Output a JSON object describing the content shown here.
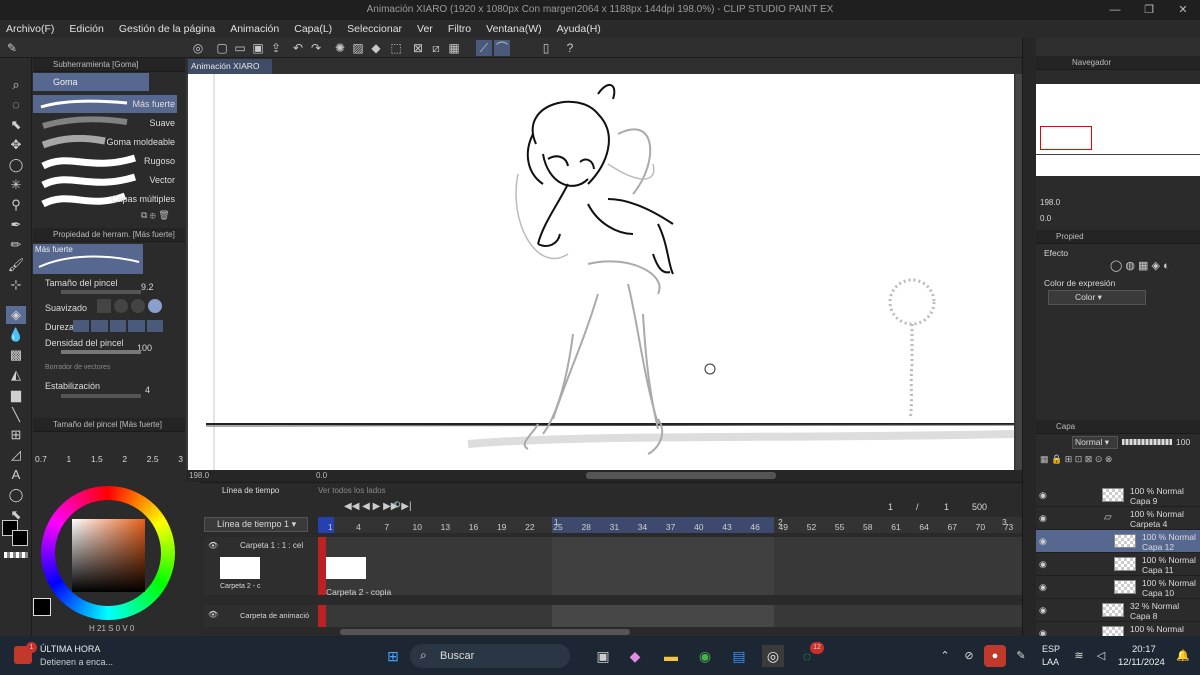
{
  "window": {
    "title": "Animación XIARO (1920 x 1080px Con margen2064 x 1188px 144dpi 198.0%)  - CLIP STUDIO PAINT EX",
    "minimize": "—",
    "restore": "❐",
    "close": "✕"
  },
  "menu": [
    "Archivo(F)",
    "Edición",
    "Gestión de la página",
    "Animación",
    "Capa(L)",
    "Seleccionar",
    "Ver",
    "Filtro",
    "Ventana(W)",
    "Ayuda(H)"
  ],
  "subtool": {
    "header": "Subherramienta [Goma]",
    "group": "Goma",
    "items": [
      "Más fuerte",
      "Suave",
      "Goma moldeable",
      "Rugoso",
      "Vector",
      "Capas múltiples"
    ]
  },
  "toolprop": {
    "header": "Propiedad de herram. [Más fuerte]",
    "preview_label": "Más fuerte",
    "brush_size_label": "Tamaño del pincel",
    "brush_size_value": "9.2",
    "smoothing_label": "Suavizado",
    "hardness_label": "Dureza",
    "density_label": "Densidad del pincel",
    "density_value": "100",
    "vector_erase_label": "Borrador de vectores",
    "stabilization_label": "Estabilización",
    "stabilization_value": "4"
  },
  "brushsize": {
    "header": "Tamaño del pincel [Más fuerte]",
    "sizes": [
      "0.7",
      "1",
      "1.5",
      "2",
      "2.5",
      "3"
    ]
  },
  "colorpanel": {
    "footer": "H 21  S 0  V 0"
  },
  "document": {
    "tab": "Animación XIARO",
    "tab_close": "✕",
    "zoom": "198.0",
    "angle": "0.0"
  },
  "timeline": {
    "tab": "Línea de tiempo",
    "tab2": "Ver todos los lados",
    "select": "Línea de tiempo 1",
    "frame_current": "1",
    "frame_sep": "/",
    "frame_start": "1",
    "frame_total": "500",
    "tracks": [
      {
        "name": "Carpeta 1 : 1 : cel",
        "cel1": "Carpeta 2 - c",
        "cel2": "Carpeta 2 - copia"
      },
      {
        "name": "Carpeta de animació"
      }
    ],
    "ticks": [
      "1",
      "4",
      "7",
      "10",
      "13",
      "16",
      "19",
      "22",
      "25",
      "28",
      "31",
      "34",
      "37",
      "40",
      "43",
      "46",
      "49",
      "52",
      "55",
      "58",
      "61",
      "64",
      "67",
      "70",
      "73"
    ],
    "section_labels": [
      "1",
      "2",
      "3"
    ]
  },
  "navigator": {
    "header": "Navegador",
    "zoom": "198.0",
    "angle": "0.0"
  },
  "subprops": {
    "header": "Propied",
    "effect_label": "Efecto",
    "expression_label": "Color de expresión",
    "expression_value": "Color"
  },
  "layers": {
    "header": "Capa",
    "blend": "Normal",
    "opacity": "100",
    "rows": [
      {
        "line1": "100 % Normal",
        "line2": "Capa 9",
        "indent": 1,
        "selected": false,
        "folder": false
      },
      {
        "line1": "100 % Normal",
        "line2": "Carpeta 4",
        "indent": 1,
        "selected": false,
        "folder": true
      },
      {
        "line1": "100 % Normal",
        "line2": "Capa 12",
        "indent": 2,
        "selected": true,
        "folder": false
      },
      {
        "line1": "100 % Normal",
        "line2": "Capa 11",
        "indent": 2,
        "selected": false,
        "folder": false
      },
      {
        "line1": "100 % Normal",
        "line2": "Capa 10",
        "indent": 2,
        "selected": false,
        "folder": false
      },
      {
        "line1": "32 % Normal",
        "line2": "Capa 8",
        "indent": 1,
        "selected": false,
        "folder": false
      },
      {
        "line1": "100 % Normal",
        "line2": "",
        "indent": 1,
        "selected": false,
        "folder": false
      }
    ]
  },
  "taskbar": {
    "news_title": "ÚLTIMA HORA",
    "news_text": "Detienen a enca...",
    "news_badge": "1",
    "search": "Buscar",
    "whatsapp_badge": "12",
    "lang": "ESP",
    "lang2": "LAA",
    "time": "20:17",
    "date": "12/11/2024"
  },
  "colors": {
    "accent": "#56688f",
    "panel": "#2b2b2b",
    "canvas": "#ffffff",
    "taskbar": "#1c2733"
  }
}
